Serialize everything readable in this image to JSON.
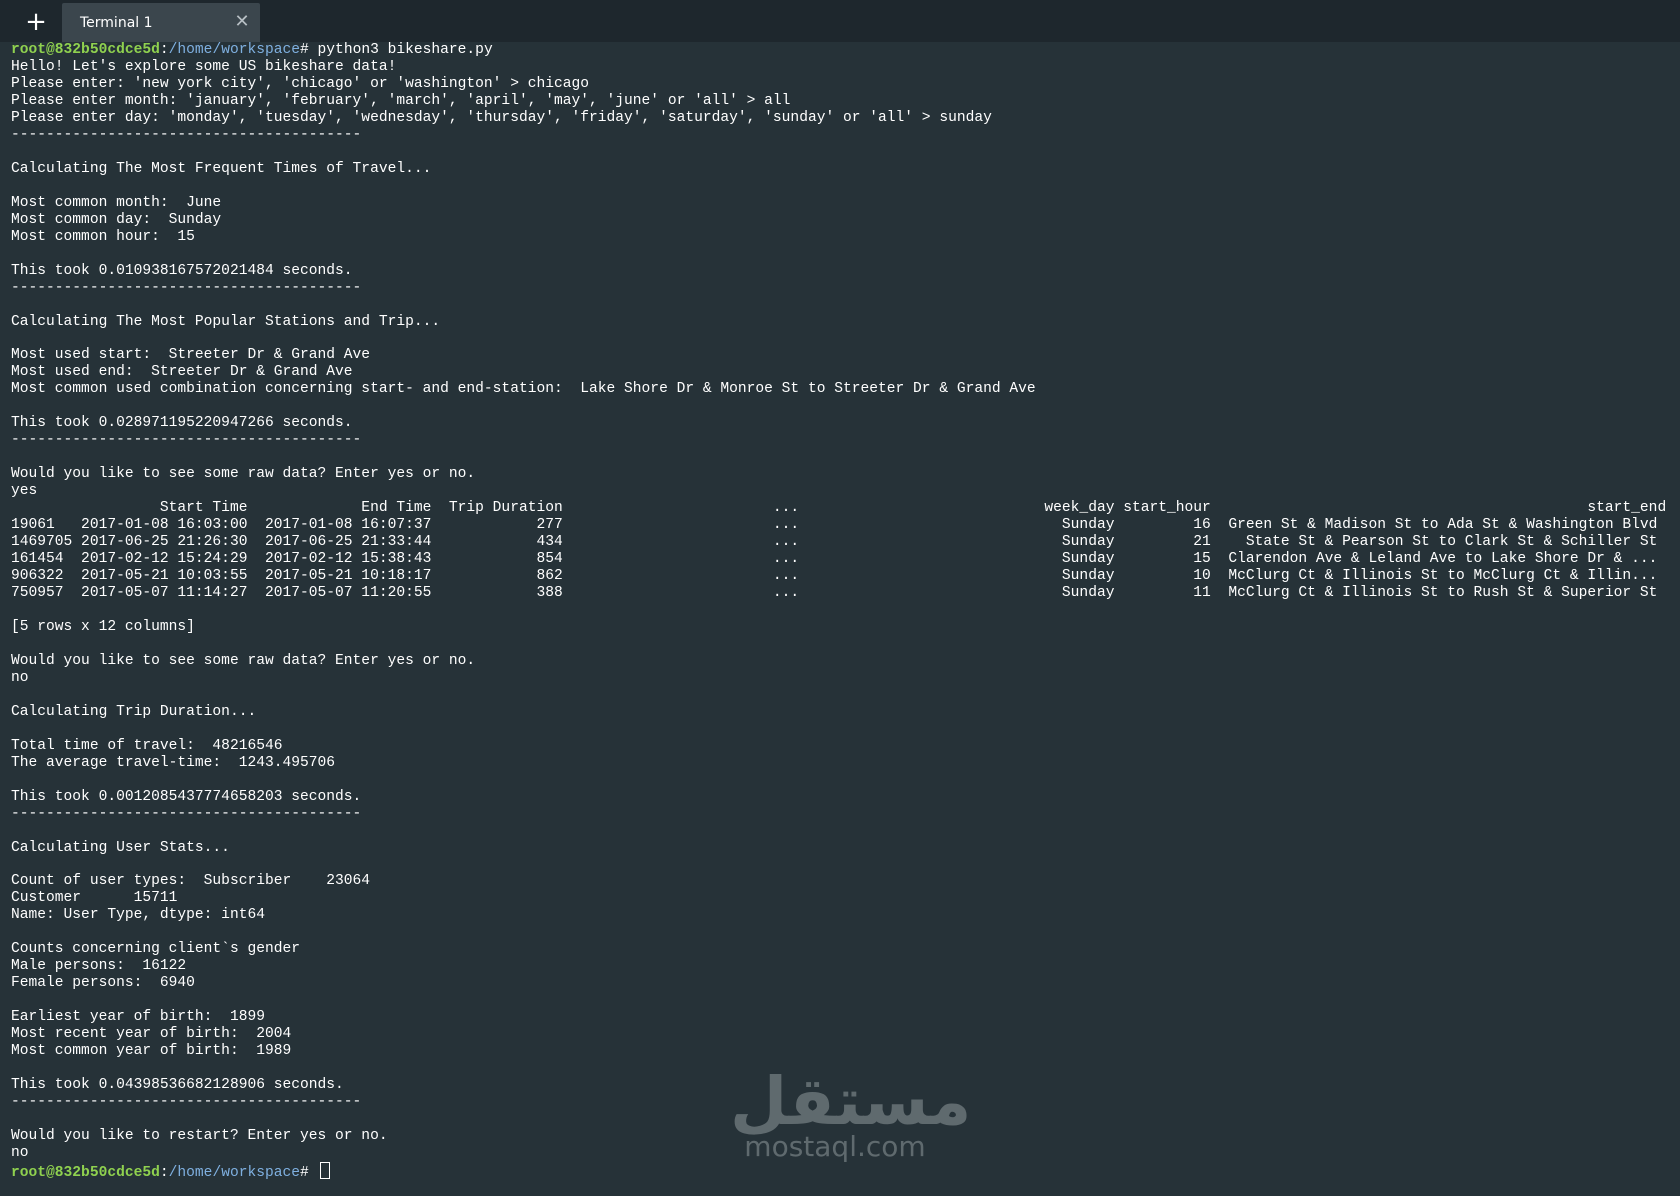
{
  "tabbar": {
    "new_tab_label": "+",
    "tab_title": "Terminal 1",
    "close_label": "✕"
  },
  "terminal": {
    "prompt_user": "root@832b50cdce5d",
    "prompt_sep": ":",
    "prompt_path": "/home/workspace",
    "prompt_end": "# ",
    "command": "python3 bikeshare.py",
    "output": [
      "Hello! Let's explore some US bikeshare data!",
      "Please enter: 'new york city', 'chicago' or 'washington' > chicago",
      "Please enter month: 'january', 'february', 'march', 'april', 'may', 'june' or 'all' > all",
      "Please enter day: 'monday', 'tuesday', 'wednesday', 'thursday', 'friday', 'saturday', 'sunday' or 'all' > sunday",
      "----------------------------------------",
      "",
      "Calculating The Most Frequent Times of Travel...",
      "",
      "Most common month:  June",
      "Most common day:  Sunday",
      "Most common hour:  15",
      "",
      "This took 0.010938167572021484 seconds.",
      "----------------------------------------",
      "",
      "Calculating The Most Popular Stations and Trip...",
      "",
      "Most used start:  Streeter Dr & Grand Ave",
      "Most used end:  Streeter Dr & Grand Ave",
      "Most common used combination concerning start- and end-station:  Lake Shore Dr & Monroe St to Streeter Dr & Grand Ave",
      "",
      "This took 0.028971195220947266 seconds.",
      "----------------------------------------",
      "",
      "Would you like to see some raw data? Enter yes or no.",
      "yes",
      "                 Start Time             End Time  Trip Duration                        ...                            week_day start_hour                                           start_end",
      "19061   2017-01-08 16:03:00  2017-01-08 16:07:37            277                        ...                              Sunday         16  Green St & Madison St to Ada St & Washington Blvd",
      "1469705 2017-06-25 21:26:30  2017-06-25 21:33:44            434                        ...                              Sunday         21    State St & Pearson St to Clark St & Schiller St",
      "161454  2017-02-12 15:24:29  2017-02-12 15:38:43            854                        ...                              Sunday         15  Clarendon Ave & Leland Ave to Lake Shore Dr & ...",
      "906322  2017-05-21 10:03:55  2017-05-21 10:18:17            862                        ...                              Sunday         10  McClurg Ct & Illinois St to McClurg Ct & Illin...",
      "750957  2017-05-07 11:14:27  2017-05-07 11:20:55            388                        ...                              Sunday         11  McClurg Ct & Illinois St to Rush St & Superior St",
      "",
      "[5 rows x 12 columns]",
      "",
      "Would you like to see some raw data? Enter yes or no.",
      "no",
      "",
      "Calculating Trip Duration...",
      "",
      "Total time of travel:  48216546",
      "The average travel-time:  1243.495706",
      "",
      "This took 0.0012085437774658203 seconds.",
      "----------------------------------------",
      "",
      "Calculating User Stats...",
      "",
      "Count of user types:  Subscriber    23064",
      "Customer      15711",
      "Name: User Type, dtype: int64",
      "",
      "Counts concerning client`s gender",
      "Male persons:  16122",
      "Female persons:  6940",
      "",
      "Earliest year of birth:  1899",
      "Most recent year of birth:  2004",
      "Most common year of birth:  1989",
      "",
      "This took 0.04398536682128906 seconds.",
      "----------------------------------------",
      "",
      "Would you like to restart? Enter yes or no.",
      "no"
    ]
  },
  "watermark": {
    "arabic": "مستقل",
    "latin": "mostaql.com"
  },
  "colors": {
    "background": "#263238",
    "tabbar": "#1e272d",
    "active_tab": "#3b464d",
    "prompt_user": "#8fd14f",
    "prompt_path": "#7fb0e0"
  }
}
